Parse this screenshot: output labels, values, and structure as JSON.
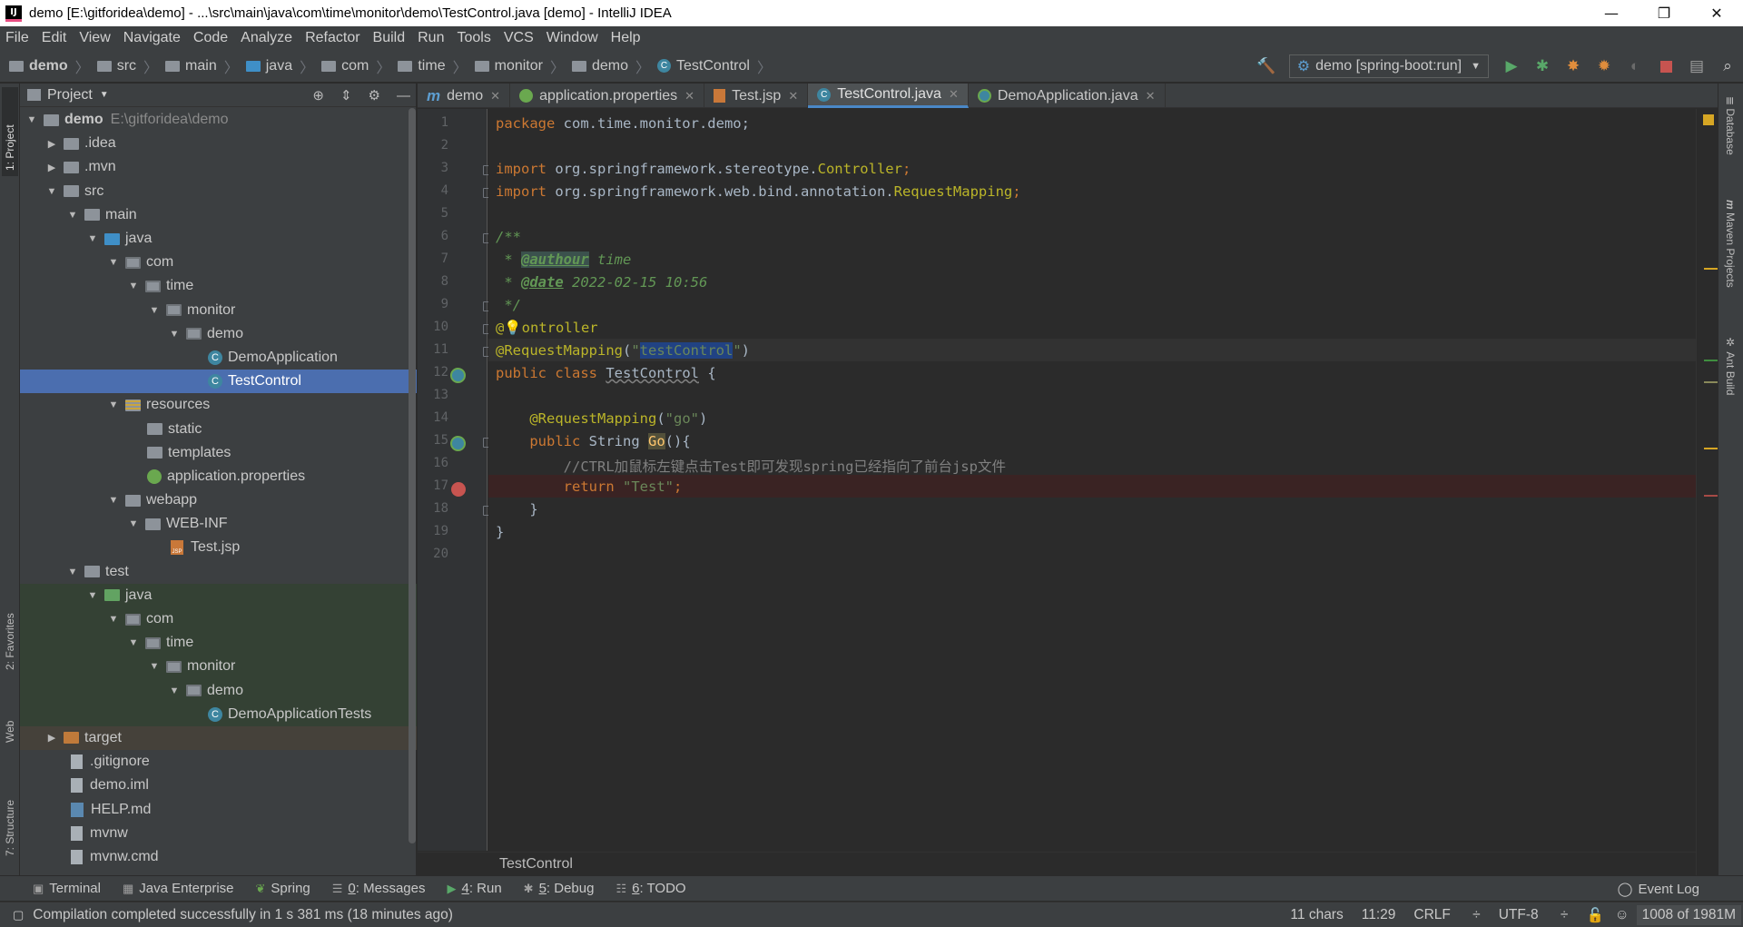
{
  "window": {
    "title": "demo [E:\\gitforidea\\demo] - ...\\src\\main\\java\\com\\time\\monitor\\demo\\TestControl.java [demo] - IntelliJ IDEA",
    "app_icon_text": "IJ"
  },
  "menu": [
    "File",
    "Edit",
    "View",
    "Navigate",
    "Code",
    "Analyze",
    "Refactor",
    "Build",
    "Run",
    "Tools",
    "VCS",
    "Window",
    "Help"
  ],
  "nav_breadcrumb": [
    "demo",
    "src",
    "main",
    "java",
    "com",
    "time",
    "monitor",
    "demo",
    "TestControl"
  ],
  "run_config": "demo [spring-boot:run]",
  "left_stripe": {
    "project": "1: Project",
    "favorites": "2: Favorites",
    "web": "Web",
    "structure": "7: Structure"
  },
  "project_panel": {
    "title": "Project",
    "tree": [
      {
        "label": "demo",
        "extra": "E:\\gitforidea\\demo"
      },
      {
        "label": ".idea"
      },
      {
        "label": ".mvn"
      },
      {
        "label": "src"
      },
      {
        "label": "main"
      },
      {
        "label": "java"
      },
      {
        "label": "com"
      },
      {
        "label": "time"
      },
      {
        "label": "monitor"
      },
      {
        "label": "demo"
      },
      {
        "label": "DemoApplication"
      },
      {
        "label": "TestControl"
      },
      {
        "label": "resources"
      },
      {
        "label": "static"
      },
      {
        "label": "templates"
      },
      {
        "label": "application.properties"
      },
      {
        "label": "webapp"
      },
      {
        "label": "WEB-INF"
      },
      {
        "label": "Test.jsp"
      },
      {
        "label": "test"
      },
      {
        "label": "java"
      },
      {
        "label": "com"
      },
      {
        "label": "time"
      },
      {
        "label": "monitor"
      },
      {
        "label": "demo"
      },
      {
        "label": "DemoApplicationTests"
      },
      {
        "label": "target"
      },
      {
        "label": ".gitignore"
      },
      {
        "label": "demo.iml"
      },
      {
        "label": "HELP.md"
      },
      {
        "label": "mvnw"
      },
      {
        "label": "mvnw.cmd"
      }
    ]
  },
  "tabs": [
    "demo",
    "application.properties",
    "Test.jsp",
    "TestControl.java",
    "DemoApplication.java"
  ],
  "editor": {
    "line_numbers": [
      "1",
      "2",
      "3",
      "4",
      "5",
      "6",
      "7",
      "8",
      "9",
      "10",
      "11",
      "12",
      "13",
      "14",
      "15",
      "16",
      "17",
      "18",
      "19",
      "20"
    ],
    "code": {
      "l1_kw": "package",
      "l1_rest": " com.time.monitor.demo;",
      "l3_kw": "import",
      "l3_rest": " org.springframework.stereotype.",
      "l3_cls": "Controller",
      "l3_end": ";",
      "l4_kw": "import",
      "l4_rest": " org.springframework.web.bind.annotation.",
      "l4_cls": "RequestMapping",
      "l4_end": ";",
      "l6": "/**",
      "l7_pre": " * ",
      "l7_tag": "@authour",
      "l7_rest": " time",
      "l8_pre": " * ",
      "l8_tag": "@date",
      "l8_rest": " 2022-02-15 10:56",
      "l9": " */",
      "l10_at": "@",
      "l10_rest": "ontroller",
      "l11_ann": "@RequestMapping",
      "l11_open": "(",
      "l11_q1": "\"",
      "l11_sel": "testControl",
      "l11_q2": "\"",
      "l11_close": ")",
      "l12_kw": "public class",
      "l12_name": "TestControl",
      "l12_rest": " {",
      "l14_ann": "@RequestMapping",
      "l14_open": "(",
      "l14_str": "\"go\"",
      "l14_close": ")",
      "l15_kw": "public",
      "l15_mid": " String ",
      "l15_name": "Go",
      "l15_rest": "(){",
      "l16": "//CTRL加鼠标左键点击Test即可发现spring已经指向了前台jsp文件",
      "l17_kw": "return",
      "l17_str": " \"Test\"",
      "l17_end": ";",
      "l18": "}",
      "l19": "}"
    },
    "bottom_breadcrumb": "TestControl"
  },
  "right_stripe": {
    "database": "Database",
    "maven": "Maven Projects",
    "ant": "Ant Build"
  },
  "bottom_tools": [
    {
      "key": "",
      "label": "Terminal"
    },
    {
      "key": "",
      "label": "Java Enterprise"
    },
    {
      "key": "",
      "label": "Spring"
    },
    {
      "key": "0",
      "label": ": Messages"
    },
    {
      "key": "4",
      "label": ": Run"
    },
    {
      "key": "5",
      "label": ": Debug"
    },
    {
      "key": "6",
      "label": ": TODO"
    }
  ],
  "event_log": "Event Log",
  "status": {
    "message": "Compilation completed successfully in 1 s 381 ms (18 minutes ago)",
    "chars": "11 chars",
    "position": "11:29",
    "line_sep": "CRLF",
    "encoding": "UTF-8",
    "memory": "1008 of 1981M"
  },
  "colors": {
    "accent": "#4b6eaf",
    "breakpoint": "#c75450",
    "keyword": "#cc7832",
    "annotation": "#bbb529",
    "string": "#6a8759"
  }
}
